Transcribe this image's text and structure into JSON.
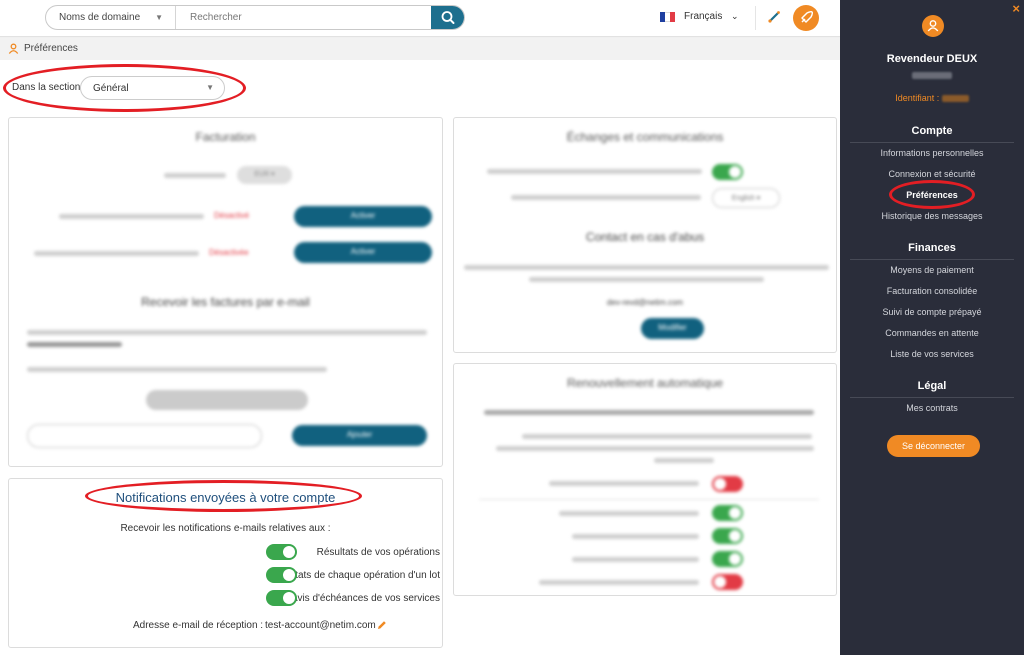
{
  "topbar": {
    "search": {
      "domain_select": "Noms de domaine",
      "placeholder": "Rechercher"
    },
    "language": "Français",
    "icons": [
      "search-icon",
      "pen-icon",
      "rocket-icon"
    ],
    "accent_color": "#f08a24",
    "search_button_color": "#1d6f8e"
  },
  "breadcrumb": {
    "label": "Préférences",
    "icon": "user-icon"
  },
  "section_picker": {
    "label": "Dans la section",
    "value": "Général"
  },
  "notifications": {
    "title": "Notifications envoyées à votre compte",
    "subtitle": "Recevoir les notifications e-mails relatives aux :",
    "items": [
      {
        "label": "Résultats de vos opérations",
        "enabled": true
      },
      {
        "label": "Résultats de chaque opération d'un lot",
        "enabled": true
      },
      {
        "label": "Avis d'échéances de vos services",
        "enabled": true
      }
    ],
    "email_label": "Adresse e-mail de réception :",
    "email_value": "test-account@netim.com"
  },
  "blurred_cards": {
    "billing_title": "Facturation",
    "invoices_title": "Recevoir les factures par e-mail",
    "exchanges_title": "Échanges et communications",
    "abuse_title": "Contact en cas d'abus",
    "renewal_title": "Renouvellement automatique",
    "status_off": "Désactivé",
    "status_off_f": "Désactivée",
    "enable_button": "Activer",
    "modify_button": "Modifier",
    "add_button": "Ajouter",
    "currency": "EUR",
    "language_pref": "English",
    "abuse_email": "dev-revd@netim.com",
    "renewal_toggles": [
      false,
      true,
      true,
      true,
      false
    ]
  },
  "sidebar": {
    "close": "×",
    "user_name": "Revendeur DEUX",
    "id_label": "Identifiant :",
    "sections": [
      {
        "title": "Compte",
        "items": [
          "Informations personnelles",
          "Connexion et sécurité",
          "Préférences",
          "Historique des messages"
        ]
      },
      {
        "title": "Finances",
        "items": [
          "Moyens de paiement",
          "Facturation consolidée",
          "Suivi de compte prépayé",
          "Commandes en attente",
          "Liste de vos services"
        ]
      },
      {
        "title": "Légal",
        "items": [
          "Mes contrats"
        ]
      }
    ],
    "active_item": "Préférences",
    "logout": "Se déconnecter",
    "background_color": "#2a2d3a"
  },
  "highlight_color": "#e31e24"
}
